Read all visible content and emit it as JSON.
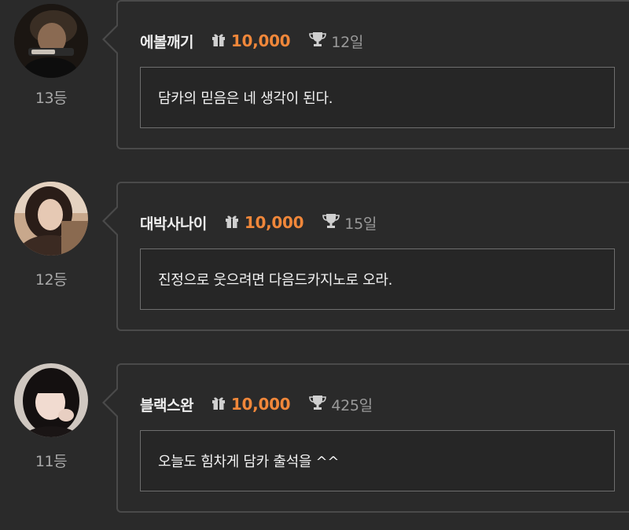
{
  "comments": [
    {
      "rank": "13등",
      "username": "에볼깨기",
      "points": "10,000",
      "days": "12일",
      "message": "담카의 믿음은 네 생각이 된다.",
      "icons": {
        "points": "gift-icon",
        "days": "trophy-icon"
      }
    },
    {
      "rank": "12등",
      "username": "대박사나이",
      "points": "10,000",
      "days": "15일",
      "message": "진정으로 웃으려면 다음드카지노로 오라.",
      "icons": {
        "points": "gift-icon",
        "days": "trophy-icon"
      }
    },
    {
      "rank": "11등",
      "username": "블랙스완",
      "points": "10,000",
      "days": "425일",
      "message": "오늘도 힘차게 담카 출석을 ^^",
      "icons": {
        "points": "gift-icon",
        "days": "trophy-icon"
      }
    }
  ],
  "colors": {
    "background": "#2a2a2a",
    "card_border": "#4a4a4a",
    "points_accent": "#f0873a",
    "username": "#eeeeee",
    "secondary_text": "#9a9a9a"
  }
}
